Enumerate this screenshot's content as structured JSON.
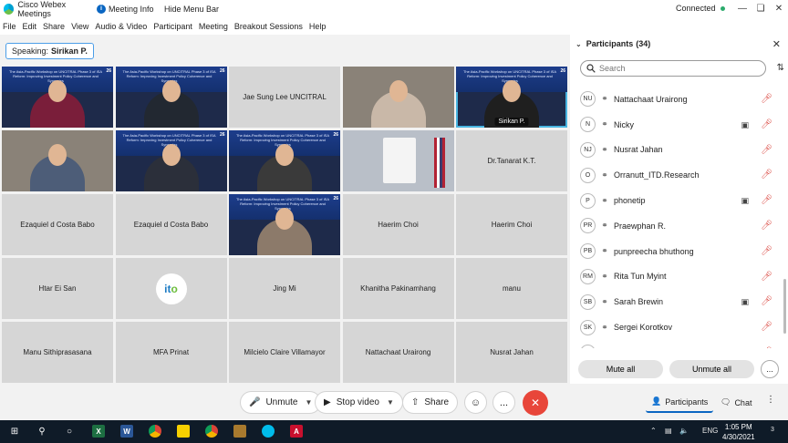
{
  "titlebar": {
    "app_name": "Cisco Webex Meetings",
    "meeting_info": "Meeting Info",
    "hide_menu": "Hide Menu Bar",
    "connection_status": "Connected",
    "status_color": "#2bab6c"
  },
  "menu": [
    "File",
    "Edit",
    "Share",
    "View",
    "Audio & Video",
    "Participant",
    "Meeting",
    "Breakout Sessions",
    "Help"
  ],
  "speaking": {
    "label": "Speaking:",
    "name": "Sirikan P."
  },
  "slide_text": "The Asia-Pacific Workshop on UNCITRAL Phase 3 of ISA Reform: Improving Investment Policy Coherence and Synergies",
  "slide_number": "26",
  "grid": [
    {
      "kind": "video",
      "label": "",
      "shirt": "#7a1e3a"
    },
    {
      "kind": "video",
      "label": "",
      "shirt": "#222831"
    },
    {
      "kind": "name",
      "label": "Jae Sung Lee UNCITRAL"
    },
    {
      "kind": "webcam",
      "label": "",
      "shirt": "#c9b8a8"
    },
    {
      "kind": "video",
      "label": "Sirikan P.",
      "active": true,
      "shirt": "#1f1f1f"
    },
    {
      "kind": "webcam",
      "label": "",
      "shirt": "#4d5d78"
    },
    {
      "kind": "video",
      "label": "",
      "shirt": "#2b2f3a"
    },
    {
      "kind": "video",
      "label": "",
      "shirt": "#3a3a3a"
    },
    {
      "kind": "room",
      "label": ""
    },
    {
      "kind": "name",
      "label": "Dr.Tanarat K.T."
    },
    {
      "kind": "name",
      "label": "Ezaquiel d Costa Babo"
    },
    {
      "kind": "name",
      "label": "Ezaquiel d Costa Babo"
    },
    {
      "kind": "video",
      "label": "",
      "shirt": "#8c7a6a"
    },
    {
      "kind": "name",
      "label": "Haerim Choi"
    },
    {
      "kind": "name",
      "label": "Haerim Choi"
    },
    {
      "kind": "name",
      "label": "Htar Ei San"
    },
    {
      "kind": "logo",
      "label": ""
    },
    {
      "kind": "name",
      "label": "Jing Mi"
    },
    {
      "kind": "name",
      "label": "Khanitha Pakinamhang"
    },
    {
      "kind": "name",
      "label": "manu"
    },
    {
      "kind": "name",
      "label": "Manu Sithiprasasana"
    },
    {
      "kind": "name",
      "label": "MFA Prinat"
    },
    {
      "kind": "name",
      "label": "Milcielo Claire Villamayor"
    },
    {
      "kind": "name",
      "label": "Nattachaat Urairong"
    },
    {
      "kind": "name",
      "label": "Nusrat Jahan"
    }
  ],
  "ito_logo": {
    "left": "it",
    "right": "o"
  },
  "participants": {
    "title": "Participants",
    "count": "(34)",
    "search_placeholder": "Search",
    "list": [
      {
        "initials": "NU",
        "name": "Nattachaat Urairong",
        "camera": false
      },
      {
        "initials": "N",
        "name": "Nicky",
        "camera": true
      },
      {
        "initials": "NJ",
        "name": "Nusrat Jahan",
        "camera": false
      },
      {
        "initials": "O",
        "name": "Orranutt_ITD.Research",
        "camera": false
      },
      {
        "initials": "P",
        "name": "phonetip",
        "camera": true
      },
      {
        "initials": "PR",
        "name": "Praewphan R.",
        "camera": false
      },
      {
        "initials": "PB",
        "name": "punpreecha bhuthong",
        "camera": false
      },
      {
        "initials": "RM",
        "name": "Rita Tun Myint",
        "camera": false
      },
      {
        "initials": "SB",
        "name": "Sarah Brewin",
        "camera": true
      },
      {
        "initials": "SK",
        "name": "Sergei Korotkov",
        "camera": false
      },
      {
        "initials": "S",
        "name": "Shafiuddin",
        "camera": false
      }
    ],
    "mute_all": "Mute all",
    "unmute_all": "Unmute all",
    "more": "..."
  },
  "controls": {
    "unmute": "Unmute",
    "stop_video": "Stop video",
    "share": "Share",
    "more": "...",
    "participants_tab": "Participants",
    "chat_tab": "Chat",
    "end_color": "#e8463a"
  },
  "taskbar": {
    "language": "ENG",
    "time": "1:05 PM",
    "date": "4/30/2021",
    "notifications": "3"
  }
}
